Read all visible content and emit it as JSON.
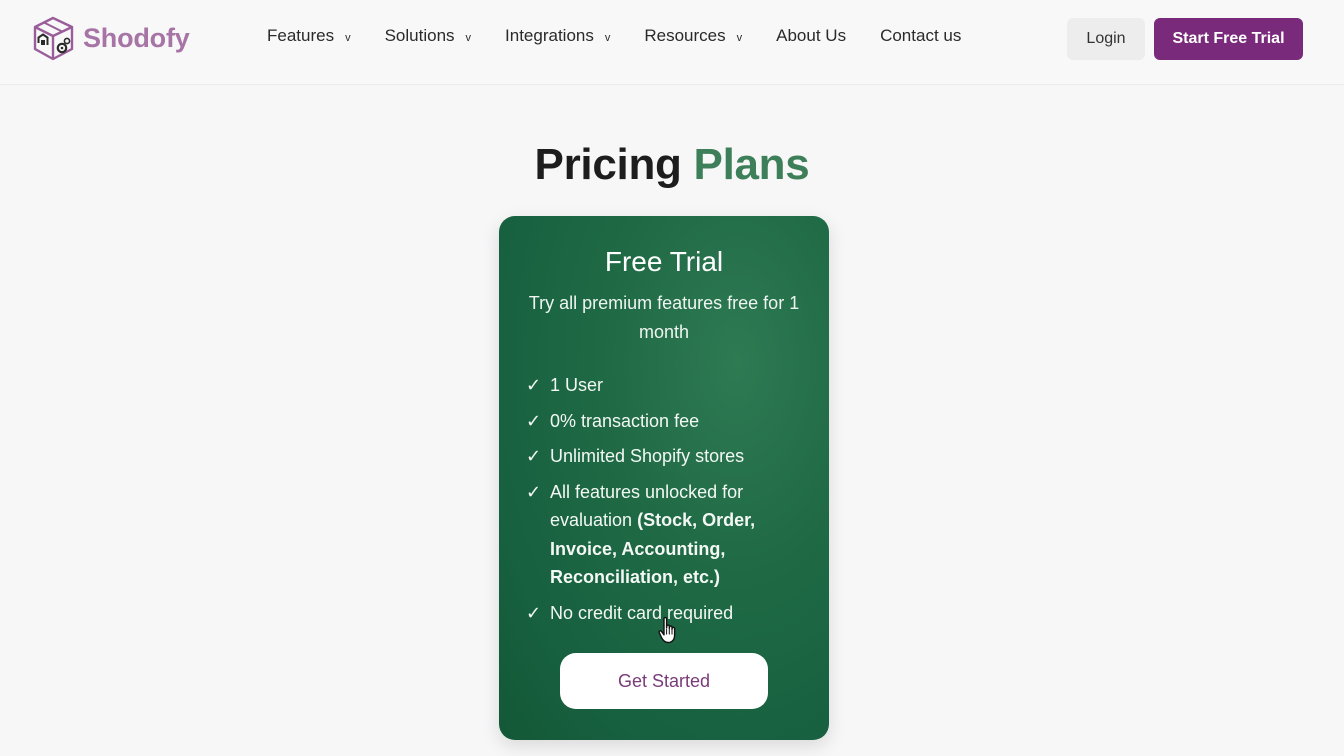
{
  "brand": {
    "name": "Shodofy",
    "logo_icon": "box-warehouse-gear-icon",
    "color": "#a774a6"
  },
  "nav": {
    "items": [
      {
        "label": "Features",
        "dropdown": true,
        "icon": "chevron-down-icon"
      },
      {
        "label": "Solutions",
        "dropdown": true,
        "icon": "chevron-down-icon"
      },
      {
        "label": "Integrations",
        "dropdown": true,
        "icon": "chevron-down-icon"
      },
      {
        "label": "Resources",
        "dropdown": true,
        "icon": "chevron-down-icon"
      },
      {
        "label": "About Us",
        "dropdown": false
      },
      {
        "label": "Contact us",
        "dropdown": false
      }
    ],
    "chevron_glyph": "v",
    "login_label": "Login",
    "trial_label": "Start Free Trial",
    "trial_color": "#7a2a7a"
  },
  "hero": {
    "title_part1": "Pricing",
    "title_part2": "Plans",
    "accent_color": "#3d7f59"
  },
  "plan": {
    "title": "Free Trial",
    "subtitle": "Try all premium features free for 1 month",
    "check_glyph": "✓",
    "features": [
      {
        "text": "1 User",
        "bold": ""
      },
      {
        "text": "0% transaction fee",
        "bold": ""
      },
      {
        "text": "Unlimited Shopify stores",
        "bold": ""
      },
      {
        "text": "All features unlocked for evaluation ",
        "bold": "(Stock, Order, Invoice, Accounting, Reconciliation, etc.)"
      },
      {
        "text": "No credit card required",
        "bold": ""
      }
    ],
    "cta_label": "Get Started",
    "card_color": "#1f6a45"
  },
  "cursor": {
    "icon": "hand-pointer-icon"
  }
}
